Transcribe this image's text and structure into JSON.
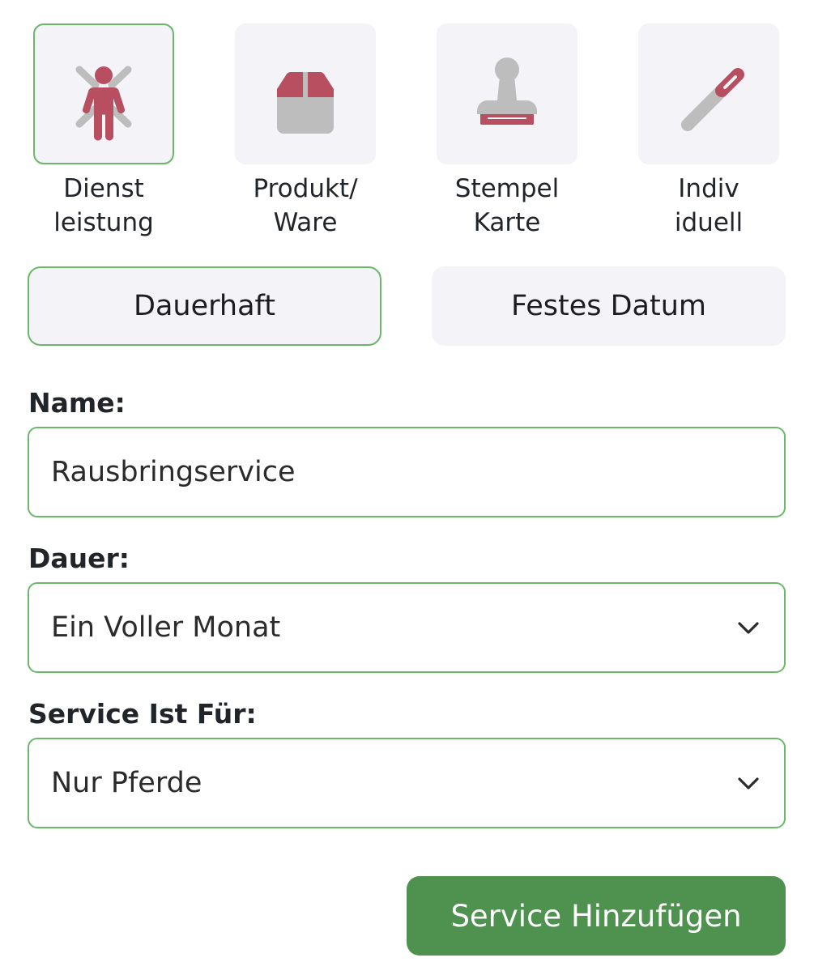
{
  "types": [
    {
      "label": "Dienst\nleistung",
      "icon": "person-service-icon",
      "active": true
    },
    {
      "label": "Produkt/\nWare",
      "icon": "box-icon",
      "active": false
    },
    {
      "label": "Stempel\nKarte",
      "icon": "stamp-icon",
      "active": false
    },
    {
      "label": "Indiv\niduell",
      "icon": "pen-icon",
      "active": false
    }
  ],
  "validity": {
    "permanent_label": "Dauerhaft",
    "fixed_date_label": "Festes Datum",
    "selected": "Dauerhaft"
  },
  "form": {
    "name_label": "Name:",
    "name_value": "Rausbringservice",
    "duration_label": "Dauer:",
    "duration_value": "Ein Voller Monat",
    "service_for_label": "Service Ist Für:",
    "service_for_value": "Nur Pferde"
  },
  "submit_label": "Service Hinzufügen",
  "colors": {
    "accent_green": "#6bb86b",
    "button_green": "#4f914f",
    "icon_red": "#b84f61",
    "icon_grey": "#bdbdbd",
    "tile_bg": "#f3f3f8"
  }
}
